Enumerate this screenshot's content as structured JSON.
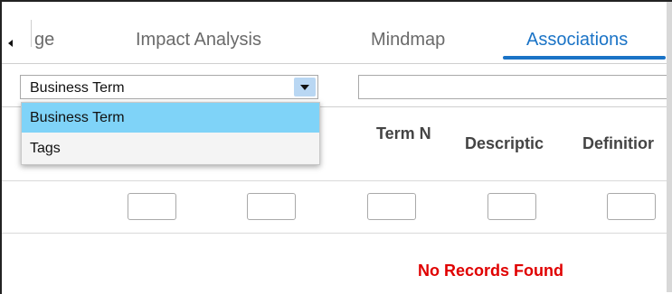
{
  "tabs": [
    {
      "label": "ge",
      "active": false
    },
    {
      "label": "Impact Analysis",
      "active": false
    },
    {
      "label": "Mindmap",
      "active": false
    },
    {
      "label": "Associations",
      "active": true
    }
  ],
  "filter": {
    "type_select": {
      "value": "Business Term",
      "options": [
        "Business Term",
        "Tags"
      ]
    },
    "search_value": ""
  },
  "table": {
    "columns": [
      "Term Name",
      "Descriptic",
      "Definitior"
    ],
    "empty_message": "No Records Found"
  },
  "colors": {
    "accent": "#1a73c6",
    "selected_option": "#7fd3f8",
    "empty_message": "#e00000"
  }
}
